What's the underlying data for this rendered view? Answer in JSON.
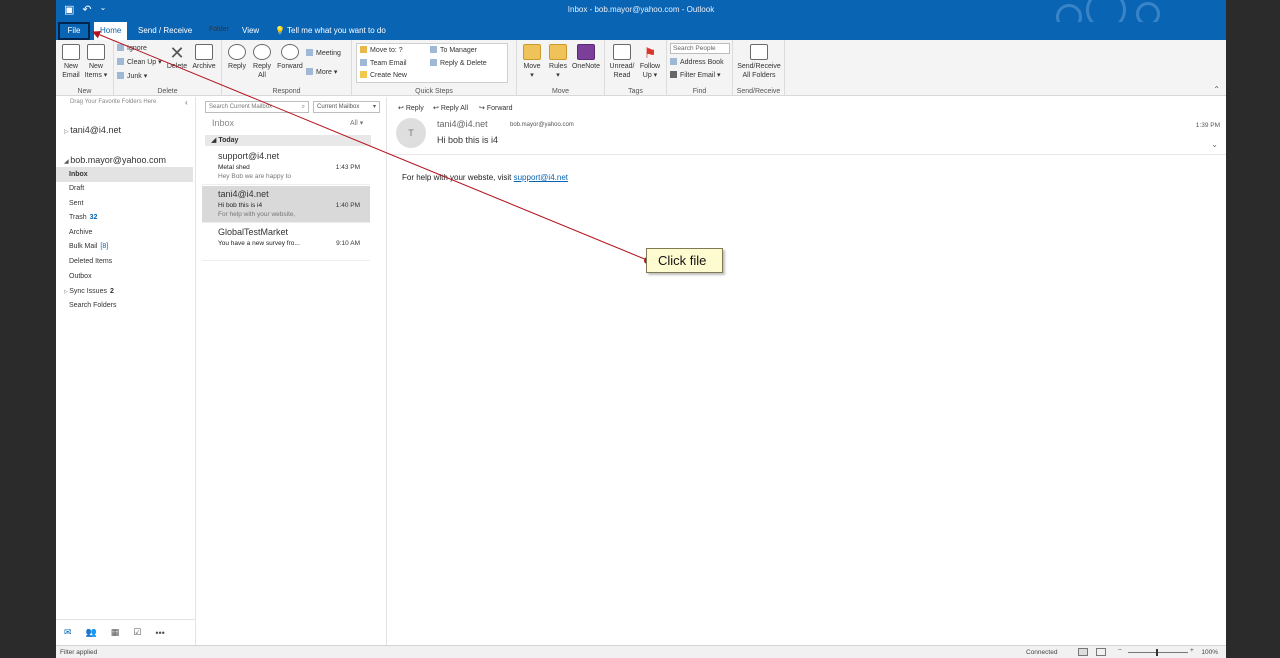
{
  "window": {
    "title": "Inbox - bob.mayor@yahoo.com - Outlook"
  },
  "qat": {
    "undo_glyph": "↶",
    "customize_glyph": "⌄"
  },
  "tabs": [
    "File",
    "Home",
    "Send / Receive",
    "Folder",
    "View",
    "Tell me what you want to do"
  ],
  "ribbon": {
    "new": {
      "new_email": "New\nEmail",
      "new_items": "New\nItems ▾",
      "label": "New"
    },
    "delete": {
      "ignore": "Ignore",
      "clean_up": "Clean Up ▾",
      "junk": "Junk ▾",
      "delete": "Delete",
      "archive": "Archive",
      "label": "Delete"
    },
    "respond": {
      "reply": "Reply",
      "reply_all": "Reply\nAll",
      "forward": "Forward",
      "meeting": "Meeting",
      "more": "More ▾",
      "label": "Respond"
    },
    "quick_steps": {
      "move_to": "Move to: ?",
      "team_email": "Team Email",
      "create_new": "Create New",
      "to_manager": "To Manager",
      "reply_delete": "Reply & Delete",
      "label": "Quick Steps"
    },
    "move": {
      "move": "Move\n▾",
      "rules": "Rules\n▾",
      "onenote": "OneNote",
      "label": "Move"
    },
    "tags": {
      "unread_read": "Unread/\nRead",
      "follow_up": "Follow\nUp ▾",
      "label": "Tags"
    },
    "find": {
      "search_people": "Search People",
      "address_book": "Address Book",
      "filter_email": "Filter Email ▾",
      "label": "Find"
    },
    "send_receive": {
      "send_receive_all": "Send/Receive\nAll Folders",
      "label": "Send/Receive"
    }
  },
  "folder_pane": {
    "favorites_hint": "Drag Your Favorite Folders Here",
    "accounts": [
      {
        "name": "tani4@i4.net"
      },
      {
        "name": "bob.mayor@yahoo.com"
      }
    ],
    "folders": [
      {
        "name": "Inbox",
        "count": ""
      },
      {
        "name": "Draft",
        "count": ""
      },
      {
        "name": "Sent",
        "count": ""
      },
      {
        "name": "Trash",
        "count": "32"
      },
      {
        "name": "Archive",
        "count": ""
      },
      {
        "name": "Bulk Mail",
        "count": "[8]"
      },
      {
        "name": "Deleted Items",
        "count": ""
      },
      {
        "name": "Outbox",
        "count": ""
      },
      {
        "name": "Sync Issues",
        "count": "2"
      },
      {
        "name": "Search Folders",
        "count": ""
      }
    ],
    "nav_icons": [
      "mail-icon",
      "people-icon",
      "calendar-icon",
      "tasks-icon",
      "more-icon"
    ]
  },
  "message_list": {
    "search_placeholder": "Search Current Mailbox",
    "scope": "Current Mailbox",
    "folder_title": "Inbox",
    "filter": "All",
    "group": "Today",
    "messages": [
      {
        "from": "support@i4.net",
        "subject": "Metal shed",
        "preview": "Hey Bob we are happy to",
        "time": "1:43 PM"
      },
      {
        "from": "tani4@i4.net",
        "subject": "Hi bob this is i4",
        "preview": "For help with your website,",
        "time": "1:40 PM"
      },
      {
        "from": "GlobalTestMarket",
        "subject": "You have a new survey fro...",
        "preview": "",
        "time": "9:10 AM"
      }
    ]
  },
  "reading_pane": {
    "actions": {
      "reply": "Reply",
      "reply_all": "Reply All",
      "forward": "Forward"
    },
    "avatar_initial": "T",
    "sender": "tani4@i4.net",
    "to": "bob.mayor@yahoo.com",
    "subject": "Hi bob this is i4",
    "time": "1:39 PM",
    "body_text": "For help with your webste, visit ",
    "body_link": "support@i4.net"
  },
  "status_bar": {
    "left": "Filter applied",
    "connection": "Connected",
    "zoom": "100%"
  },
  "annotation": {
    "text": "Click file"
  },
  "colors": {
    "accent": "#0a64b4",
    "callout_bg": "#fffbd1",
    "arrow": "#b3141e"
  }
}
